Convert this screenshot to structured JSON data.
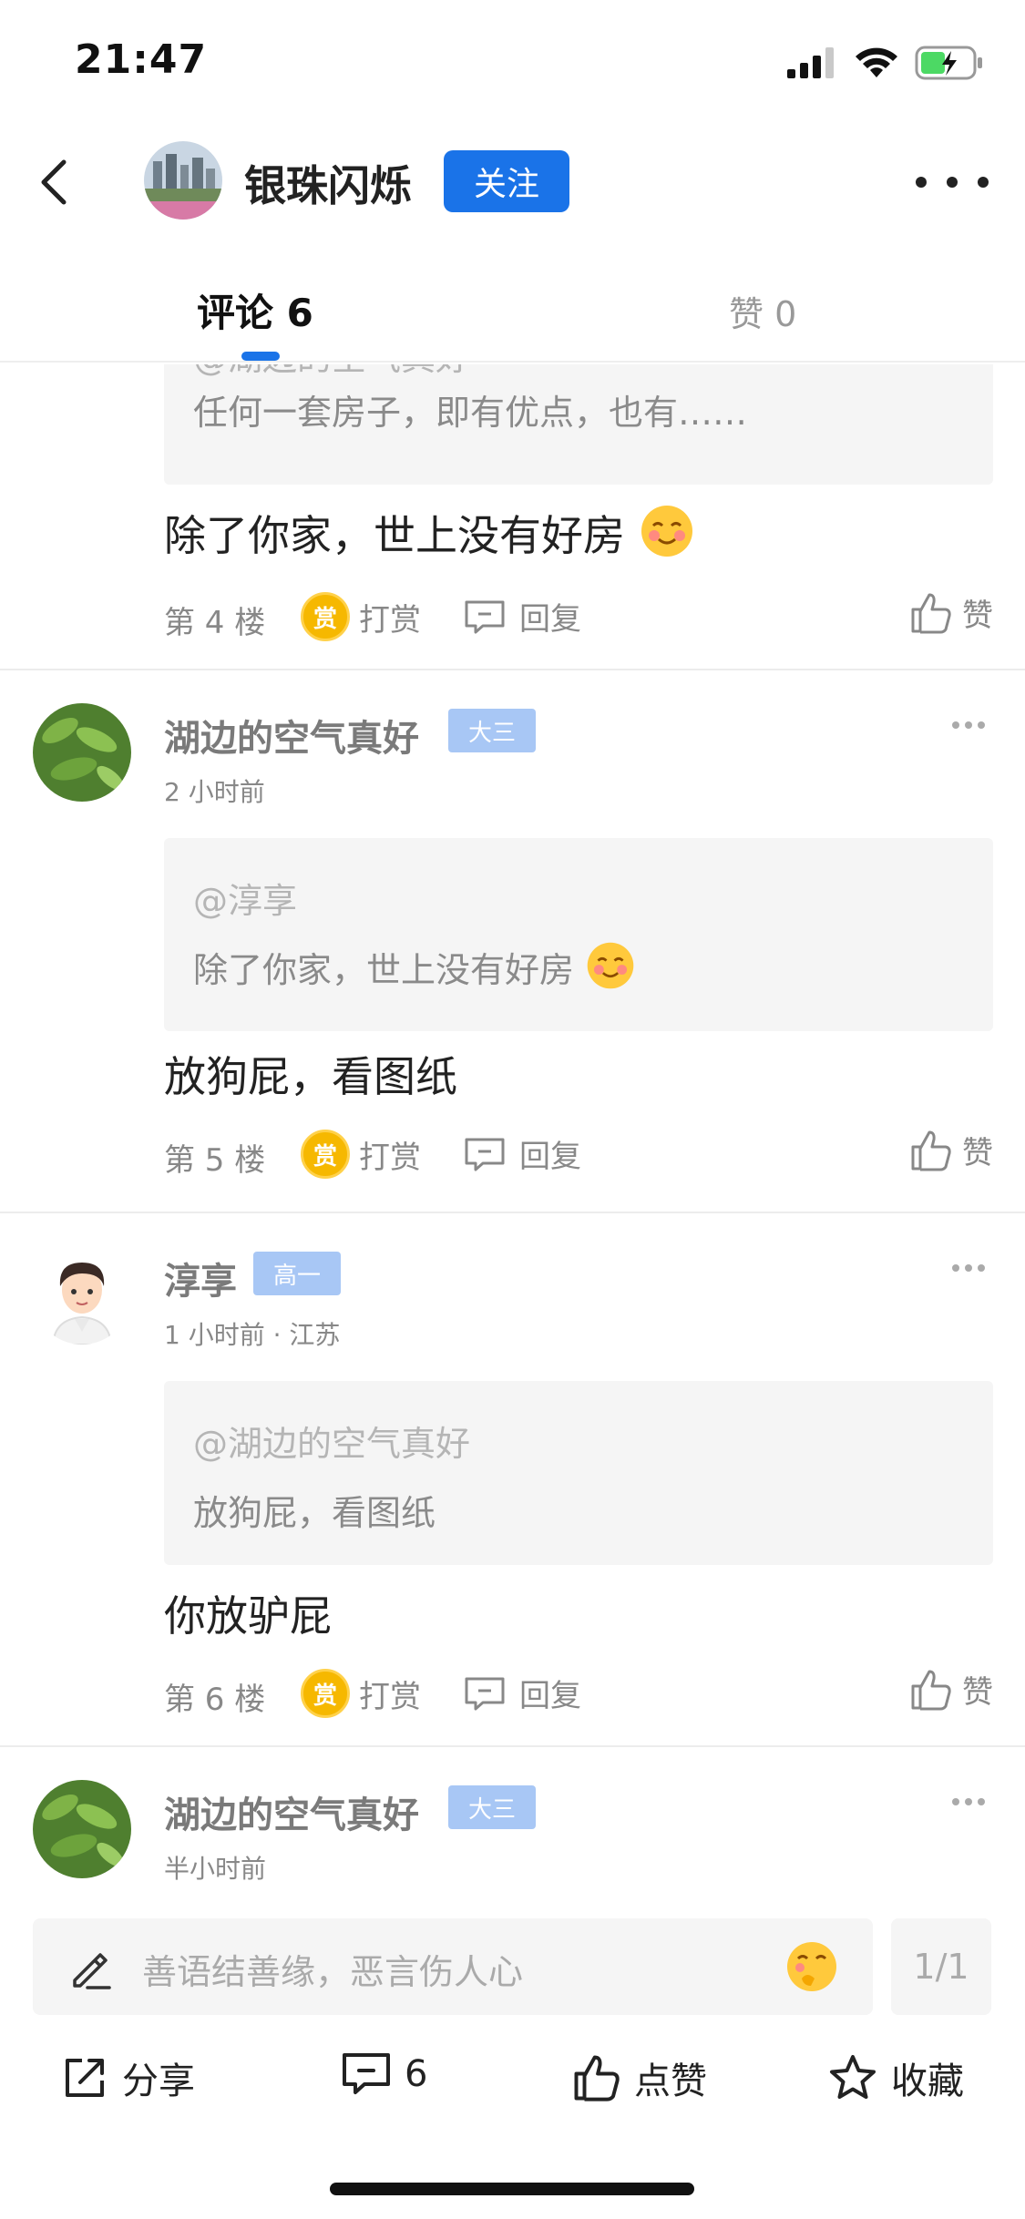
{
  "status_bar": {
    "time": "21:47"
  },
  "header": {
    "author_name": "银珠闪烁",
    "follow_label": "关注"
  },
  "tabs": [
    {
      "label": "评论 6",
      "active": true
    },
    {
      "label": "赞 0",
      "active": false
    }
  ],
  "partial_comment": {
    "quote_at": "@湖边的空气真好",
    "quote_text": "任何一套房子，即有优点，也有……",
    "text": "除了你家，世上没有好房",
    "floor": "第 4 楼",
    "reward_label": "打赏",
    "reply_label": "回复",
    "like_label": "赞"
  },
  "comments": [
    {
      "name": "湖边的空气真好",
      "badge": "大三",
      "time": "2 小时前",
      "quote_at": "@淳享",
      "quote_text": "除了你家，世上没有好房",
      "text": "放狗屁，看图纸",
      "floor": "第 5 楼",
      "reward_label": "打赏",
      "reply_label": "回复",
      "like_label": "赞"
    },
    {
      "name": "淳享",
      "badge": "高一",
      "time": "1 小时前 · 江苏",
      "quote_at": "@湖边的空气真好",
      "quote_text": "放狗屁，看图纸",
      "text": "你放驴屁",
      "floor": "第 6 楼",
      "reward_label": "打赏",
      "reply_label": "回复",
      "like_label": "赞"
    },
    {
      "name": "湖边的空气真好",
      "badge": "大三",
      "time": "半小时前"
    }
  ],
  "reward_coin_char": "赏",
  "input": {
    "placeholder": "善语结善缘，恶言伤人心",
    "page_indicator": "1/1"
  },
  "bottom_actions": {
    "share": "分享",
    "comments_count": "6",
    "like": "点赞",
    "favorite": "收藏"
  },
  "colors": {
    "accent": "#1a73e8",
    "badge": "#a8c7f5",
    "coin": "#f6b800"
  }
}
